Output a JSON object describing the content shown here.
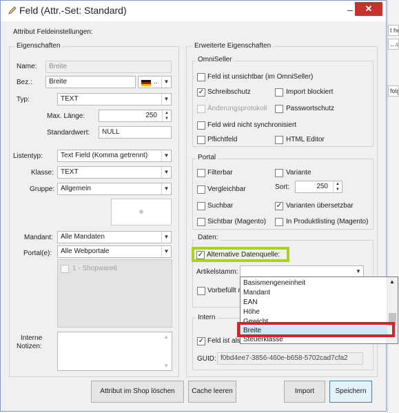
{
  "window": {
    "title": "Feld (Attr.-Set: Standard)"
  },
  "background": {
    "cells": [
      "t he",
      "…usc",
      "folg"
    ]
  },
  "header": {
    "section_title": "Attribut Feldeinstellungen:"
  },
  "eigenschaften": {
    "legend": "Eigenschaften",
    "name_label": "Name:",
    "name_value": "Breite",
    "bez_label": "Bez.:",
    "bez_value": "Breite",
    "lang_suffix": "..",
    "typ_label": "Typ:",
    "typ_value": "TEXT",
    "max_laenge_label": "Max. Länge:",
    "max_laenge_value": "250",
    "standardwert_label": "Standardwert:",
    "standardwert_value": "NULL",
    "listentyp_label": "Listentyp:",
    "listentyp_value": "Text Field (Komma getrennt)",
    "klasse_label": "Klasse:",
    "klasse_value": "TEXT",
    "gruppe_label": "Gruppe:",
    "gruppe_value": "Allgemein",
    "mandant_label": "Mandant:",
    "mandant_value": "Alle Mandaten",
    "portal_label": "Portal(e):",
    "portal_value": "Alle Webportale",
    "portal_items": [
      "1 - Shopware6"
    ],
    "notizen_label_1": "Interne",
    "notizen_label_2": "Notizen:"
  },
  "erweitert": {
    "legend": "Erweiterte Eigenschaften",
    "omniseller": {
      "legend": "OmniSeller",
      "feld_unsichtbar": "Feld ist unsichtbar (im OmniSeller)",
      "schreibschutz": "Schreibschutz",
      "import_blockiert": "Import blockiert",
      "aenderungsprotokoll": "Änderungsprotokoll",
      "passwortschutz": "Passwortschutz",
      "nicht_synchronisiert": "Feld wird nicht synchronisiert",
      "pflichtfeld": "Pflichtfeld",
      "html_editor": "HTML Editor"
    },
    "portal": {
      "legend": "Portal",
      "filterbar": "Filterbar",
      "variante": "Variante",
      "vergleichbar": "Vergleichbar",
      "sort_label": "Sort:",
      "sort_value": "250",
      "suchbar": "Suchbar",
      "varianten_uebersetzbar": "Varianten übersetzbar",
      "sichtbar_magento": "Sichtbar (Magento)",
      "in_produktlisting": "In Produktlisting (Magento)"
    },
    "daten": {
      "legend": "Daten:",
      "alternative_datenquelle": "Alternative Datenquelle:",
      "artikelstamm_label": "Artikelstamm:",
      "vorbefuellt": "Vorbefüllt m"
    },
    "intern": {
      "legend": "Intern",
      "feld_ist_als": "Feld ist als",
      "guid_label": "GUID:",
      "guid_value": "f0bd4ee7-3856-460e-b658-5702cad7cfa2"
    }
  },
  "dropdown": {
    "items": [
      "Basismengeneinheit",
      "Mandant",
      "EAN",
      "Höhe",
      "Gewicht",
      "Breite",
      "Steuerklasse"
    ],
    "selected": "Breite"
  },
  "buttons": {
    "delete_attr": "Attribut im Shop löschen",
    "cache_leeren": "Cache leeren",
    "import": "Import",
    "speichern": "Speichern"
  },
  "colors": {
    "highlight_green": "#a9d126",
    "highlight_red": "#d9202b",
    "close_red": "#c7312c"
  },
  "icons": [
    "pencil-icon",
    "flag-de-icon",
    "chevron-down-icon",
    "spin-arrows-icon",
    "check-icon",
    "close-icon",
    "minimize-icon"
  ]
}
